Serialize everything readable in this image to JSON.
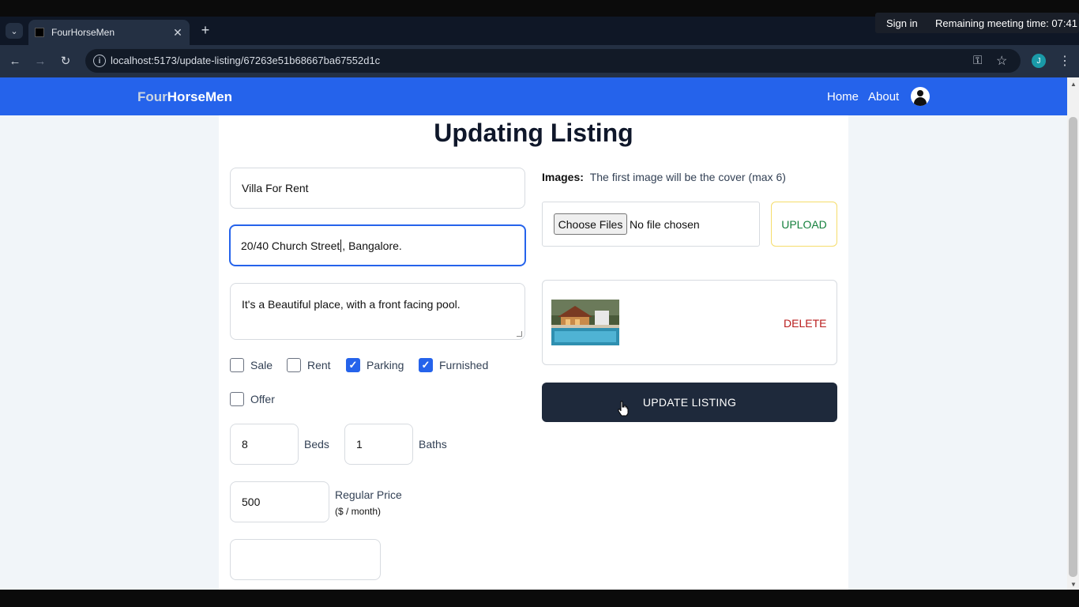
{
  "browser": {
    "tab_title": "FourHorseMen",
    "new_tab": "+",
    "tab_close": "✕",
    "url": "localhost:5173/update-listing/67263e51b68667ba67552d1c",
    "profile_initial": "J"
  },
  "meeting": {
    "sign_in": "Sign in",
    "remaining": "Remaining meeting time: 07:41"
  },
  "header": {
    "brand_part1": "Four",
    "brand_part2": "HorseMen",
    "nav_home": "Home",
    "nav_about": "About"
  },
  "form": {
    "title": "Updating Listing",
    "name": "Villa For Rent",
    "address_before_caret": "20/40 Church Street",
    "address_after_caret": ", Bangalore.",
    "description": "It's a Beautiful place, with a front facing pool.",
    "checkboxes": {
      "sale": {
        "label": "Sale",
        "checked": false
      },
      "rent": {
        "label": "Rent",
        "checked": false
      },
      "parking": {
        "label": "Parking",
        "checked": true
      },
      "furnished": {
        "label": "Furnished",
        "checked": true
      },
      "offer": {
        "label": "Offer",
        "checked": false
      }
    },
    "beds": "8",
    "beds_label": "Beds",
    "baths": "1",
    "baths_label": "Baths",
    "regular_price": "500",
    "regular_price_label": "Regular Price",
    "regular_price_unit": "($ / month)",
    "discount_price": ""
  },
  "images": {
    "label_bold": "Images:",
    "label_text": "The first image will be the cover (max 6)",
    "choose_files": "Choose Files",
    "no_file": "No file chosen",
    "upload": "UPLOAD",
    "delete": "DELETE"
  },
  "actions": {
    "update_listing": "UPDATE LISTING"
  },
  "colors": {
    "header_bg": "#2563eb",
    "update_btn_bg": "#1e293b",
    "upload_text": "#15803d",
    "delete_text": "#b91c1c"
  }
}
